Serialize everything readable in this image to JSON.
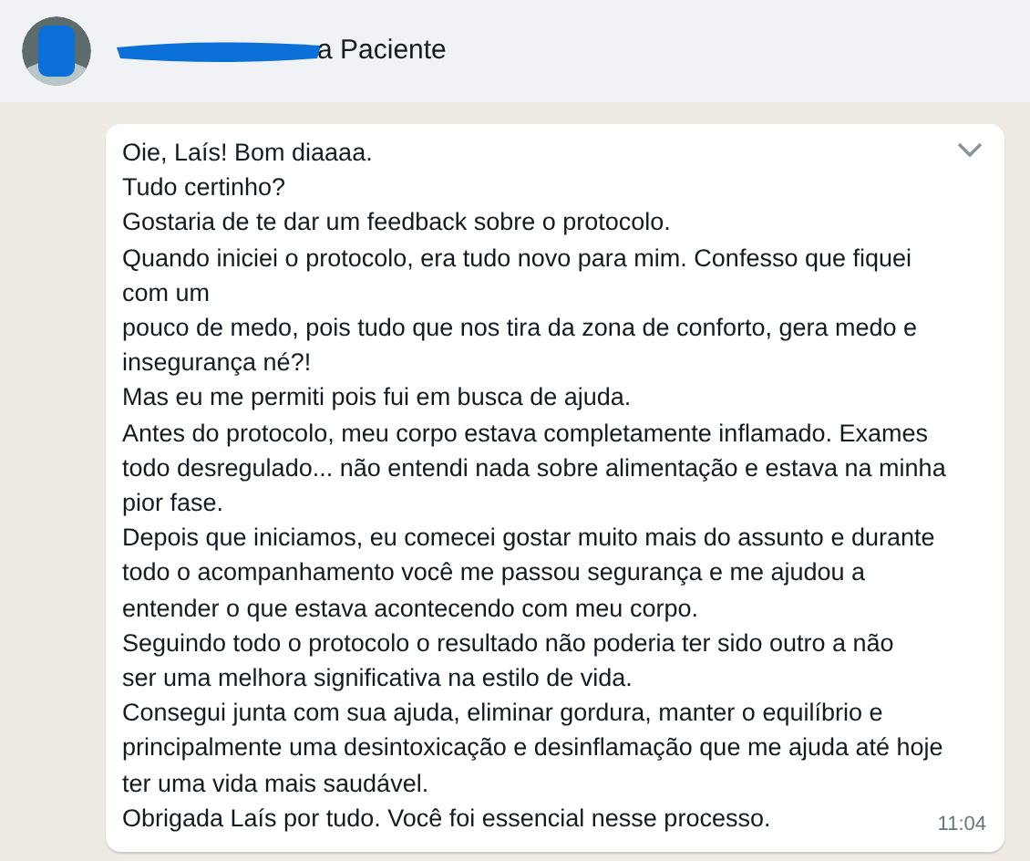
{
  "header": {
    "contact_name": "a Paciente"
  },
  "message": {
    "lines": [
      "Oie, Laís! Bom diaaaa.",
      "Tudo certinho?",
      "Gostaria de te dar um feedback sobre o protocolo.",
      "Quando iniciei o protocolo, era tudo novo para mim. Confesso que fiquei",
      "com um",
      "pouco de medo, pois tudo que nos tira da zona de conforto, gera medo e",
      "insegurança né?!",
      "Mas eu me permiti pois fui em busca de ajuda.",
      "Antes do protocolo, meu corpo estava completamente inflamado. Exames",
      "todo desregulado... não entendi nada sobre alimentação e estava na minha",
      "pior fase.",
      "Depois que iniciamos, eu comecei gostar muito mais do assunto e durante",
      "todo o acompanhamento você me passou segurança e me ajudou a",
      "entender o que estava acontecendo com meu corpo.",
      "Seguindo todo o protocolo o resultado não poderia ter sido outro a não",
      "ser uma melhora significativa na estilo de vida.",
      "Consegui junta com sua ajuda, eliminar gordura, manter o equilíbrio e",
      "principalmente uma desintoxicação e desinflamação que me ajuda até hoje",
      "ter uma vida mais saudável.",
      "Obrigada Laís por tudo. Você foi essencial nesse processo."
    ],
    "time": "11:04"
  }
}
